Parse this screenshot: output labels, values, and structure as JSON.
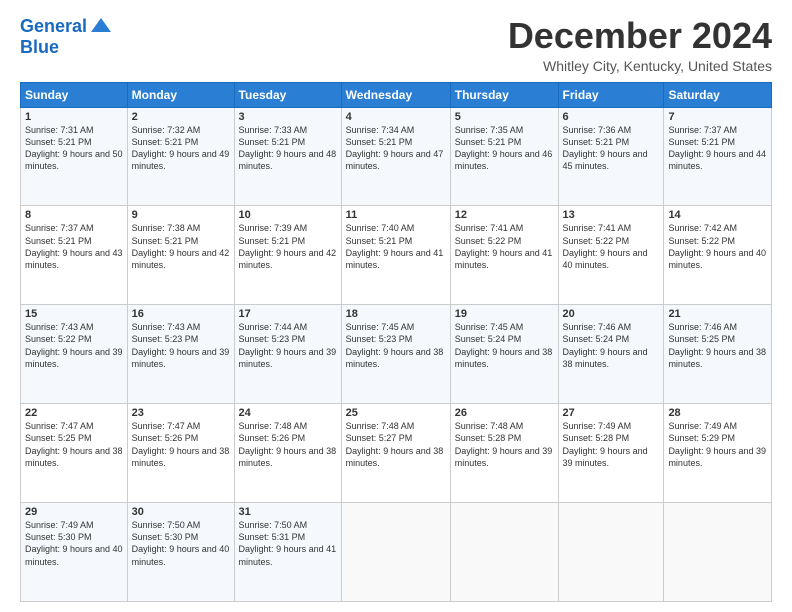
{
  "logo": {
    "line1": "General",
    "line2": "Blue"
  },
  "header": {
    "title": "December 2024",
    "location": "Whitley City, Kentucky, United States"
  },
  "weekdays": [
    "Sunday",
    "Monday",
    "Tuesday",
    "Wednesday",
    "Thursday",
    "Friday",
    "Saturday"
  ],
  "weeks": [
    [
      {
        "day": "1",
        "sunrise": "7:31 AM",
        "sunset": "5:21 PM",
        "daylight": "9 hours and 50 minutes."
      },
      {
        "day": "2",
        "sunrise": "7:32 AM",
        "sunset": "5:21 PM",
        "daylight": "9 hours and 49 minutes."
      },
      {
        "day": "3",
        "sunrise": "7:33 AM",
        "sunset": "5:21 PM",
        "daylight": "9 hours and 48 minutes."
      },
      {
        "day": "4",
        "sunrise": "7:34 AM",
        "sunset": "5:21 PM",
        "daylight": "9 hours and 47 minutes."
      },
      {
        "day": "5",
        "sunrise": "7:35 AM",
        "sunset": "5:21 PM",
        "daylight": "9 hours and 46 minutes."
      },
      {
        "day": "6",
        "sunrise": "7:36 AM",
        "sunset": "5:21 PM",
        "daylight": "9 hours and 45 minutes."
      },
      {
        "day": "7",
        "sunrise": "7:37 AM",
        "sunset": "5:21 PM",
        "daylight": "9 hours and 44 minutes."
      }
    ],
    [
      {
        "day": "8",
        "sunrise": "7:37 AM",
        "sunset": "5:21 PM",
        "daylight": "9 hours and 43 minutes."
      },
      {
        "day": "9",
        "sunrise": "7:38 AM",
        "sunset": "5:21 PM",
        "daylight": "9 hours and 42 minutes."
      },
      {
        "day": "10",
        "sunrise": "7:39 AM",
        "sunset": "5:21 PM",
        "daylight": "9 hours and 42 minutes."
      },
      {
        "day": "11",
        "sunrise": "7:40 AM",
        "sunset": "5:21 PM",
        "daylight": "9 hours and 41 minutes."
      },
      {
        "day": "12",
        "sunrise": "7:41 AM",
        "sunset": "5:22 PM",
        "daylight": "9 hours and 41 minutes."
      },
      {
        "day": "13",
        "sunrise": "7:41 AM",
        "sunset": "5:22 PM",
        "daylight": "9 hours and 40 minutes."
      },
      {
        "day": "14",
        "sunrise": "7:42 AM",
        "sunset": "5:22 PM",
        "daylight": "9 hours and 40 minutes."
      }
    ],
    [
      {
        "day": "15",
        "sunrise": "7:43 AM",
        "sunset": "5:22 PM",
        "daylight": "9 hours and 39 minutes."
      },
      {
        "day": "16",
        "sunrise": "7:43 AM",
        "sunset": "5:23 PM",
        "daylight": "9 hours and 39 minutes."
      },
      {
        "day": "17",
        "sunrise": "7:44 AM",
        "sunset": "5:23 PM",
        "daylight": "9 hours and 39 minutes."
      },
      {
        "day": "18",
        "sunrise": "7:45 AM",
        "sunset": "5:23 PM",
        "daylight": "9 hours and 38 minutes."
      },
      {
        "day": "19",
        "sunrise": "7:45 AM",
        "sunset": "5:24 PM",
        "daylight": "9 hours and 38 minutes."
      },
      {
        "day": "20",
        "sunrise": "7:46 AM",
        "sunset": "5:24 PM",
        "daylight": "9 hours and 38 minutes."
      },
      {
        "day": "21",
        "sunrise": "7:46 AM",
        "sunset": "5:25 PM",
        "daylight": "9 hours and 38 minutes."
      }
    ],
    [
      {
        "day": "22",
        "sunrise": "7:47 AM",
        "sunset": "5:25 PM",
        "daylight": "9 hours and 38 minutes."
      },
      {
        "day": "23",
        "sunrise": "7:47 AM",
        "sunset": "5:26 PM",
        "daylight": "9 hours and 38 minutes."
      },
      {
        "day": "24",
        "sunrise": "7:48 AM",
        "sunset": "5:26 PM",
        "daylight": "9 hours and 38 minutes."
      },
      {
        "day": "25",
        "sunrise": "7:48 AM",
        "sunset": "5:27 PM",
        "daylight": "9 hours and 38 minutes."
      },
      {
        "day": "26",
        "sunrise": "7:48 AM",
        "sunset": "5:28 PM",
        "daylight": "9 hours and 39 minutes."
      },
      {
        "day": "27",
        "sunrise": "7:49 AM",
        "sunset": "5:28 PM",
        "daylight": "9 hours and 39 minutes."
      },
      {
        "day": "28",
        "sunrise": "7:49 AM",
        "sunset": "5:29 PM",
        "daylight": "9 hours and 39 minutes."
      }
    ],
    [
      {
        "day": "29",
        "sunrise": "7:49 AM",
        "sunset": "5:30 PM",
        "daylight": "9 hours and 40 minutes."
      },
      {
        "day": "30",
        "sunrise": "7:50 AM",
        "sunset": "5:30 PM",
        "daylight": "9 hours and 40 minutes."
      },
      {
        "day": "31",
        "sunrise": "7:50 AM",
        "sunset": "5:31 PM",
        "daylight": "9 hours and 41 minutes."
      },
      null,
      null,
      null,
      null
    ]
  ]
}
